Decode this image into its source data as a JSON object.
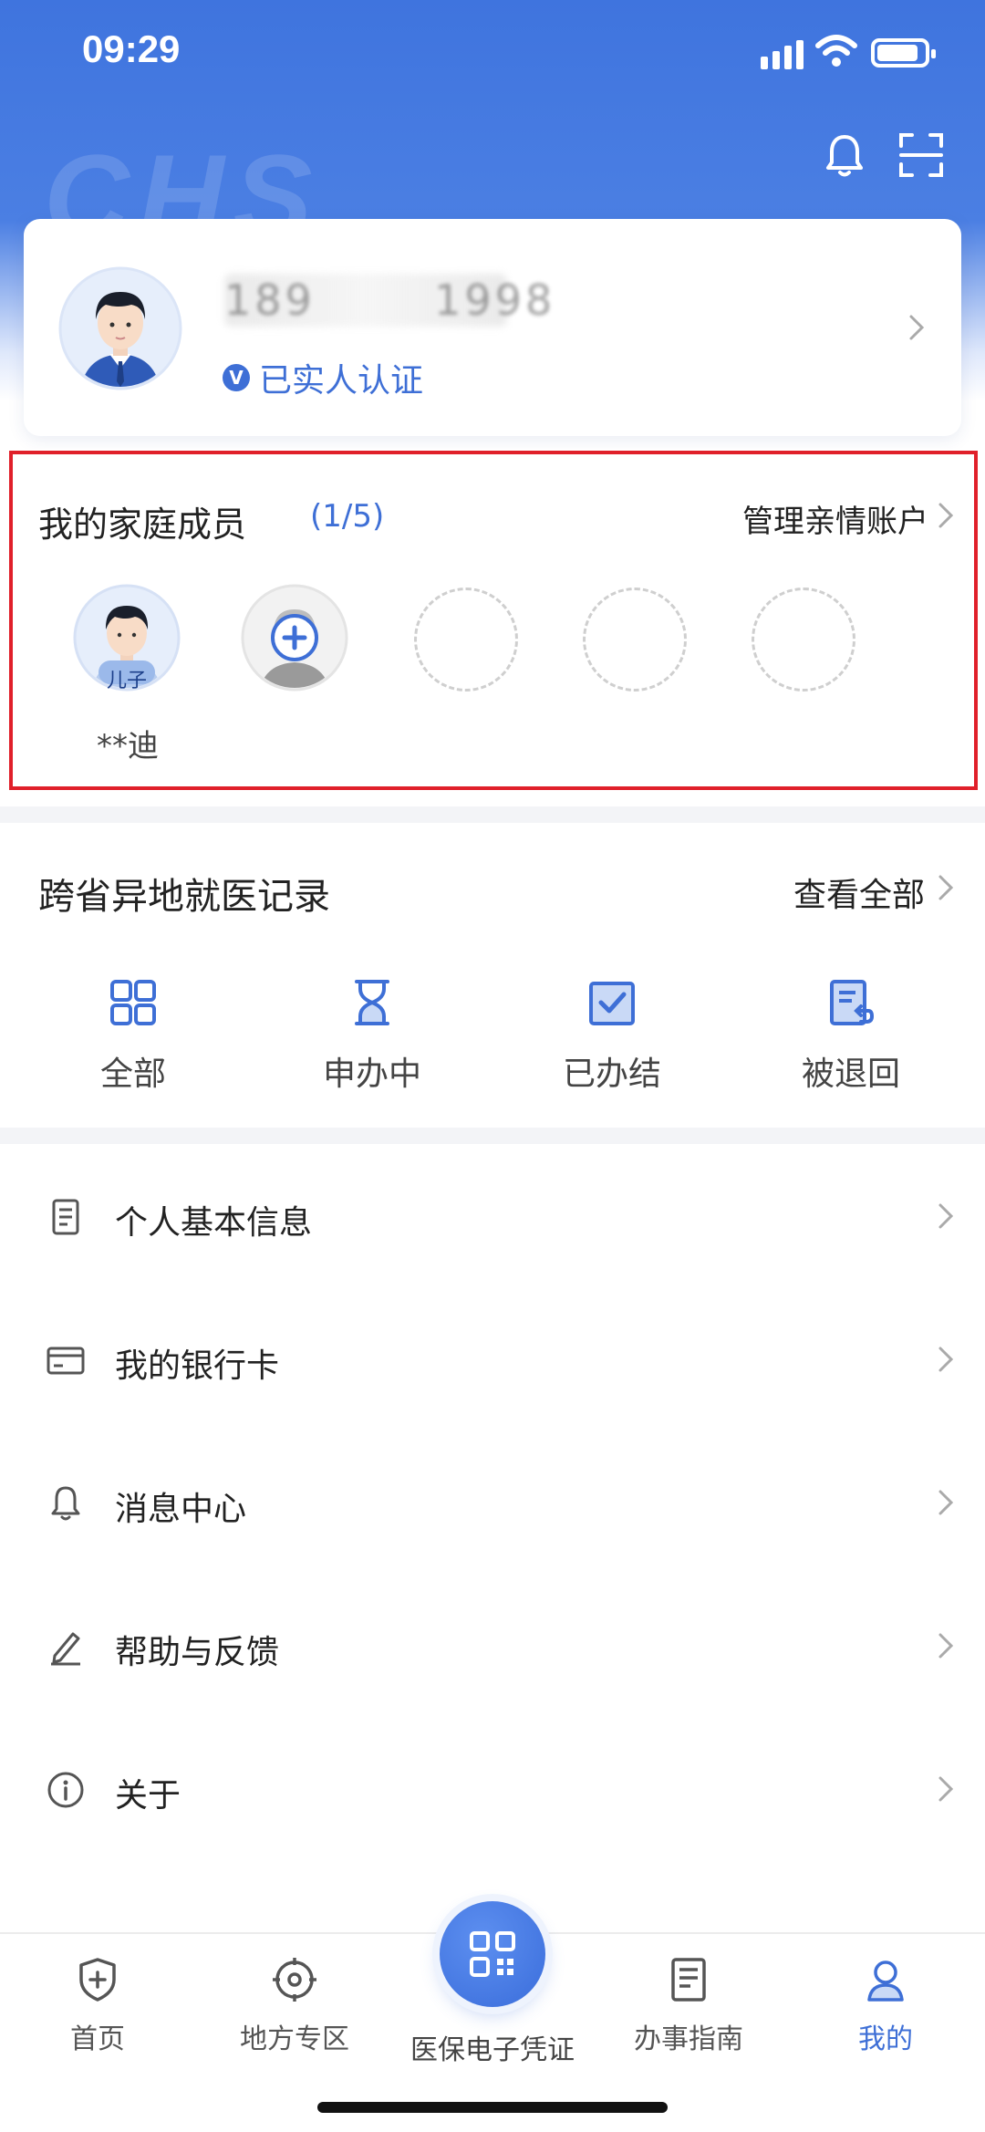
{
  "status_bar": {
    "time": "09:29"
  },
  "header": {
    "watermark": "CHS"
  },
  "profile": {
    "phone_masked": "189       1998",
    "verified_label": "已实人认证",
    "verified_mark": "V"
  },
  "family": {
    "title": "我的家庭成员",
    "count": "(1/5)",
    "manage_label": "管理亲情账户",
    "member_tag": "儿子",
    "member_name": "**迪"
  },
  "records": {
    "title": "跨省异地就医记录",
    "view_all": "查看全部",
    "items": [
      {
        "label": "全部",
        "icon": "grid-icon"
      },
      {
        "label": "申办中",
        "icon": "hourglass-icon"
      },
      {
        "label": "已办结",
        "icon": "checkbox-icon"
      },
      {
        "label": "被退回",
        "icon": "returned-doc-icon"
      }
    ]
  },
  "menu": {
    "items": [
      {
        "label": "个人基本信息",
        "icon": "document-icon"
      },
      {
        "label": "我的银行卡",
        "icon": "bank-card-icon"
      },
      {
        "label": "消息中心",
        "icon": "bell-icon"
      },
      {
        "label": "帮助与反馈",
        "icon": "pen-icon"
      },
      {
        "label": "关于",
        "icon": "info-icon"
      }
    ]
  },
  "tabbar": {
    "items": [
      {
        "label": "首页",
        "icon": "shield-plus-icon"
      },
      {
        "label": "地方专区",
        "icon": "target-icon"
      },
      {
        "label": "医保电子凭证",
        "icon": "qr-code-icon"
      },
      {
        "label": "办事指南",
        "icon": "guide-doc-icon"
      },
      {
        "label": "我的",
        "icon": "user-icon"
      }
    ],
    "active_color": "#3e6fd6"
  },
  "colors": {
    "primary": "#3e6fd6",
    "highlight_box": "#e0202a"
  }
}
